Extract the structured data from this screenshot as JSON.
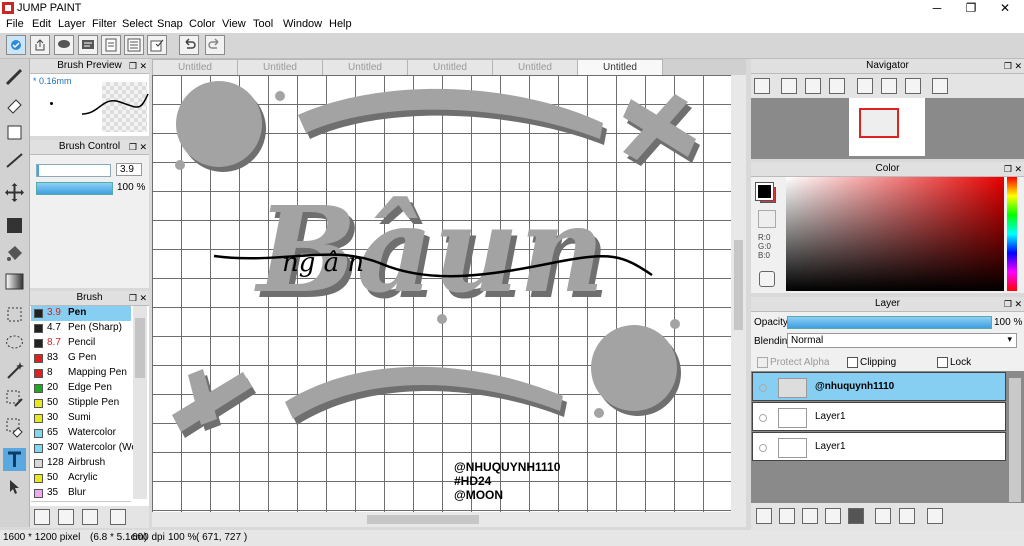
{
  "window": {
    "title": "JUMP PAINT",
    "min_glyph": "─",
    "max_glyph": "❐",
    "close_glyph": "✕"
  },
  "menu": [
    "File",
    "Edit",
    "Layer",
    "Filter",
    "Select",
    "Snap",
    "Color",
    "View",
    "Tool",
    "Window",
    "Help"
  ],
  "tabs": [
    "Untitled",
    "Untitled",
    "Untitled",
    "Untitled",
    "Untitled",
    "Untitled"
  ],
  "brush_preview": {
    "title": "Brush Preview",
    "size_label": "* 0.16mm"
  },
  "brush_control": {
    "title": "Brush Control",
    "size_value": "3.9",
    "opacity_value": "100 %"
  },
  "brush_list": {
    "title": "Brush",
    "items": [
      {
        "size": "3.9",
        "name": "Pen",
        "color": "#222222",
        "size_color": "#d32222",
        "selected": true
      },
      {
        "size": "4.7",
        "name": "Pen (Sharp)",
        "color": "#222222",
        "size_color": "#000000"
      },
      {
        "size": "8.7",
        "name": "Pencil",
        "color": "#222222",
        "size_color": "#d32222"
      },
      {
        "size": "83",
        "name": "G Pen",
        "color": "#e02020",
        "size_color": "#000000"
      },
      {
        "size": "8",
        "name": "Mapping Pen",
        "color": "#e02020",
        "size_color": "#000000"
      },
      {
        "size": "20",
        "name": "Edge Pen",
        "color": "#21a821",
        "size_color": "#000000"
      },
      {
        "size": "50",
        "name": "Stipple Pen",
        "color": "#e8e820",
        "size_color": "#000000"
      },
      {
        "size": "30",
        "name": "Sumi",
        "color": "#e8e820",
        "size_color": "#000000"
      },
      {
        "size": "65",
        "name": "Watercolor",
        "color": "#80d8f0",
        "size_color": "#000000"
      },
      {
        "size": "307",
        "name": "Watercolor (We",
        "color": "#80d8f0",
        "size_color": "#000000"
      },
      {
        "size": "128",
        "name": "Airbrush",
        "color": "#d8d8d8",
        "size_color": "#000000"
      },
      {
        "size": "50",
        "name": "Acrylic",
        "color": "#e8e820",
        "size_color": "#000000"
      },
      {
        "size": "35",
        "name": "Blur",
        "color": "#f0a8f0",
        "size_color": "#000000"
      }
    ]
  },
  "canvas_art": {
    "title_text": "Bâun",
    "script_text": "ng â n",
    "credit_lines": [
      "@NHUQUYNH1110",
      "#HD24",
      "@MOON"
    ]
  },
  "navigator": {
    "title": "Navigator"
  },
  "color_panel": {
    "title": "Color",
    "r": "R:0",
    "g": "G:0",
    "b": "B:0",
    "primary": "#000000",
    "secondary": "#d33b3b"
  },
  "layer_panel": {
    "title": "Layer",
    "opacity_label": "Opacity",
    "opacity_value": "100 %",
    "blending_label": "Blending",
    "blending_value": "Normal",
    "protect_alpha": "Protect Alpha",
    "clipping": "Clipping",
    "lock": "Lock",
    "layers": [
      {
        "name": "@nhuquynh1110",
        "selected": true
      },
      {
        "name": "Layer1",
        "selected": false
      },
      {
        "name": "Layer1",
        "selected": false
      }
    ]
  },
  "status": {
    "pixels": "1600 * 1200 pixel",
    "cm": "(6.8 * 5.1cm)",
    "dpi": "600 dpi",
    "zoom": "100 %",
    "coords": "( 671, 727 )"
  },
  "colors": {
    "accent": "#87cff2",
    "selected_tool": "#5aa8e0",
    "shape_gray": "#a3a3a3",
    "shape_shadow": "#6f6f6f"
  }
}
